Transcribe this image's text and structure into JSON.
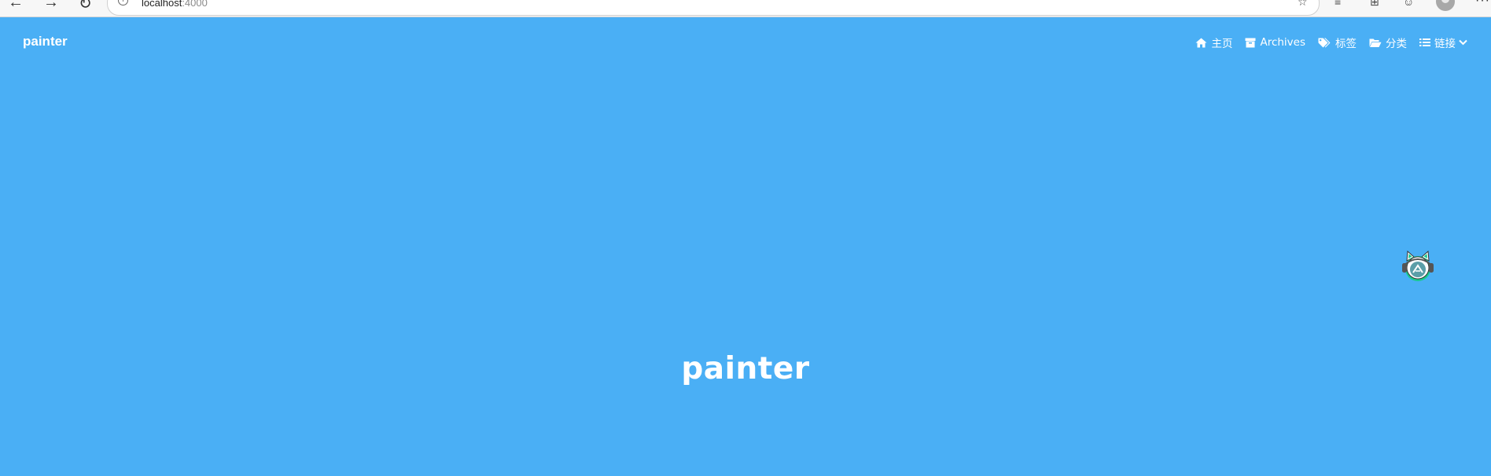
{
  "browser": {
    "address": {
      "host": "localhost",
      "port": ":4000"
    },
    "icons": [
      "back-arrow-icon",
      "forward-arrow-icon",
      "reload-icon",
      "info-icon",
      "favorite-add-icon",
      "favorites-icon",
      "collections-icon",
      "profile-icon",
      "more-icon"
    ]
  },
  "header": {
    "brand": "painter",
    "nav": [
      {
        "label": "主页",
        "icon": "home-icon"
      },
      {
        "label": "Archives",
        "icon": "archive-icon"
      },
      {
        "label": "标签",
        "icon": "tags-icon"
      },
      {
        "label": "分类",
        "icon": "folder-open-icon"
      },
      {
        "label": "链接",
        "icon": "list-icon"
      }
    ]
  },
  "hero": {
    "title": "painter"
  },
  "colors": {
    "background": "#4aaff5",
    "text": "#ffffff",
    "mascot_accent": "#19c98f"
  }
}
